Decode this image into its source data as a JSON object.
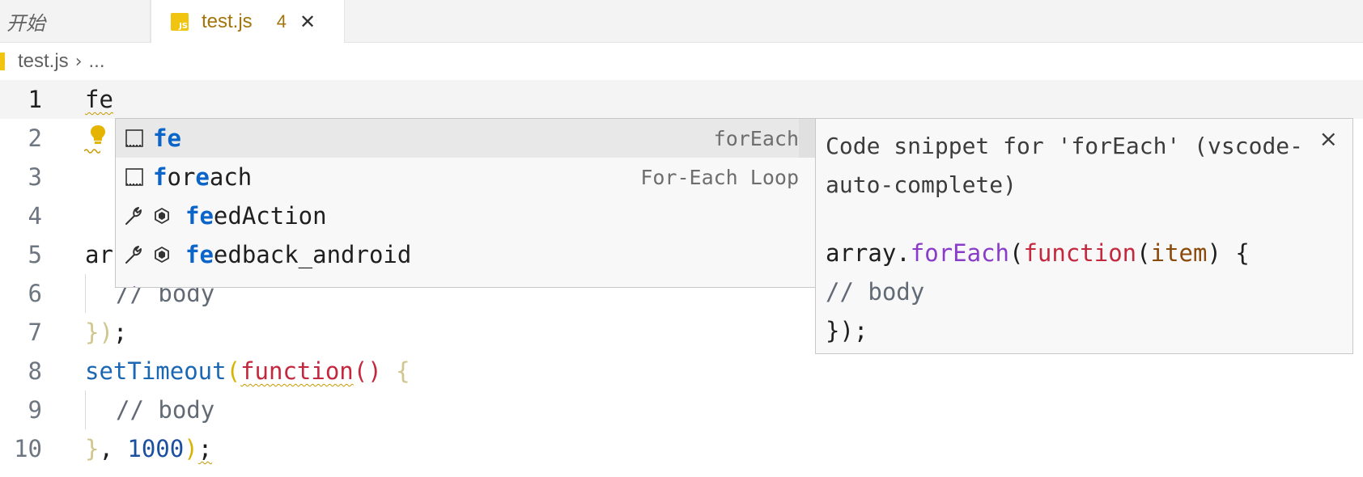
{
  "tabs": [
    {
      "label": "开始"
    },
    {
      "label": "test.js",
      "problems": "4",
      "icon": "js-file-icon"
    }
  ],
  "breadcrumb": {
    "file": "test.js",
    "more": "..."
  },
  "editor": {
    "line_numbers": [
      "1",
      "2",
      "3",
      "4",
      "5",
      "6",
      "7",
      "8",
      "9",
      "10"
    ],
    "lines": {
      "l1": "fe",
      "l5": "ar",
      "l6": "// body",
      "l7_a": "})",
      "l7_b": ";",
      "l8_fn": "setTimeout",
      "l8_p1": "(",
      "l8_kw": "function",
      "l8_p2": "()",
      "l8_b": "{",
      "l9": "// body",
      "l10_a": "}",
      "l10_b": ", ",
      "l10_num": "1000",
      "l10_c": ")",
      "l10_d": ";"
    }
  },
  "suggest": {
    "items": [
      {
        "hl": "fe",
        "rest": "",
        "detail": "forEach",
        "icon": "snippet-icon"
      },
      {
        "pre_hl": "f",
        "hl_mid": "o",
        "mid": "r",
        "hl2": "e",
        "rest": "ach",
        "detail": "For-Each Loop",
        "icon": "snippet-icon"
      },
      {
        "hl": "fe",
        "rest": "edAction",
        "icon": "wrench-icon",
        "icon2": "module-icon"
      },
      {
        "hl": "fe",
        "rest": "edback_android",
        "icon": "wrench-icon",
        "icon2": "module-icon"
      }
    ]
  },
  "details": {
    "description": "Code snippet for 'forEach' (vscode-auto-complete)",
    "code": {
      "l1_a": "array.",
      "l1_method": "forEach",
      "l1_p": "(",
      "l1_kw": "function",
      "l1_p2": "(",
      "l1_param": "item",
      "l1_end": ") {",
      "l2": "// body",
      "l3": "});"
    },
    "close": "×"
  }
}
